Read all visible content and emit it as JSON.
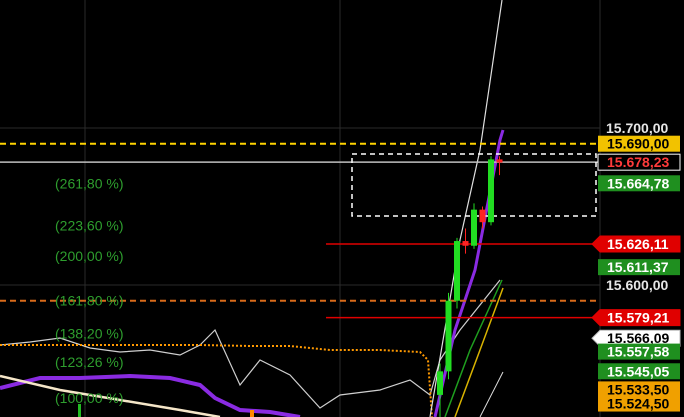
{
  "fib_levels": [
    {
      "label": "(261,80 %)",
      "price": 15664.78
    },
    {
      "label": "(223,60 %)",
      "price": 15638.0
    },
    {
      "label": "(200,00 %)",
      "price": 15618.5
    },
    {
      "label": "(161,80 %)",
      "price": 15590.0
    },
    {
      "label": "(138,20 %)",
      "price": 15569.0
    },
    {
      "label": "(123,26 %)",
      "price": 15551.0
    },
    {
      "label": "(100,00 %)",
      "price": 15528.0
    }
  ],
  "price_scale": {
    "plain": [
      {
        "text": "15.700,00",
        "price": 15700.0
      },
      {
        "text": "15.600,00",
        "price": 15600.0
      }
    ],
    "tags": [
      {
        "name": "yellow-level-tag",
        "text": "15.690,00",
        "price": 15690.0,
        "bg": "#f2c200",
        "fg": "#000000",
        "shape": "rect"
      },
      {
        "name": "last-price-tag",
        "text": "15.678,23",
        "price": 15678.23,
        "bg": "#000000",
        "fg": "#ff3b3b",
        "shape": "rect"
      },
      {
        "name": "green-level-tag",
        "text": "15.664,78",
        "price": 15664.78,
        "bg": "#1f8f1f",
        "fg": "#ffffff",
        "shape": "rect"
      },
      {
        "name": "red-level-tag",
        "text": "15.626,11",
        "price": 15626.11,
        "bg": "#e00000",
        "fg": "#ffffff",
        "shape": "arrow"
      },
      {
        "name": "green-level-tag",
        "text": "15.611,37",
        "price": 15611.37,
        "bg": "#1f8f1f",
        "fg": "#ffffff",
        "shape": "rect"
      },
      {
        "name": "red-level-tag",
        "text": "15.579,21",
        "price": 15579.21,
        "bg": "#e00000",
        "fg": "#ffffff",
        "shape": "arrow"
      },
      {
        "name": "white-level-tag",
        "text": "15.566,09",
        "price": 15566.09,
        "bg": "#ffffff",
        "fg": "#000000",
        "shape": "arrow"
      },
      {
        "name": "green-level-tag",
        "text": "15.557,58",
        "price": 15557.58,
        "bg": "#1f8f1f",
        "fg": "#ffffff",
        "shape": "rect"
      },
      {
        "name": "green-level-tag",
        "text": "15.545,05",
        "price": 15545.05,
        "bg": "#1f8f1f",
        "fg": "#ffffff",
        "shape": "rect"
      },
      {
        "name": "orange-level-tag",
        "text": "15.533,50",
        "price": 15533.5,
        "bg": "#f0a000",
        "fg": "#000000",
        "shape": "rect"
      },
      {
        "name": "orange-level-tag",
        "text": "15.524,50",
        "price": 15524.5,
        "bg": "#f0a000",
        "fg": "#000000",
        "shape": "rect"
      }
    ]
  },
  "levels": [
    {
      "name": "yellow-dashed-level",
      "price": 15690.0,
      "color": "#ffd400",
      "style": "dashed"
    },
    {
      "name": "last-price-line",
      "price": 15678.23,
      "color": "#bfbfbf",
      "style": "solid"
    },
    {
      "name": "red-level-line",
      "price": 15626.11,
      "color": "#e00000",
      "style": "solid"
    },
    {
      "name": "orange-dashed-level",
      "price": 15590.0,
      "color": "#d86a1a",
      "style": "dashed"
    },
    {
      "name": "red-level-line",
      "price": 15579.21,
      "color": "#e00000",
      "style": "solid"
    }
  ],
  "candles": [
    {
      "o": 15530,
      "h": 15550,
      "l": 15515,
      "c": 15545
    },
    {
      "o": 15545,
      "h": 15595,
      "l": 15540,
      "c": 15590
    },
    {
      "o": 15590,
      "h": 15630,
      "l": 15585,
      "c": 15628
    },
    {
      "o": 15628,
      "h": 15636,
      "l": 15620,
      "c": 15625
    },
    {
      "o": 15625,
      "h": 15652,
      "l": 15623,
      "c": 15648
    },
    {
      "o": 15648,
      "h": 15650,
      "l": 15636,
      "c": 15640
    },
    {
      "o": 15640,
      "h": 15682,
      "l": 15638,
      "c": 15680
    },
    {
      "o": 15680,
      "h": 15682,
      "l": 15670,
      "c": 15678
    }
  ],
  "colors": {
    "up": "#22dd22",
    "down": "#ff2222",
    "grid": "#2a2a2a",
    "purple": "#8a2be2"
  }
}
